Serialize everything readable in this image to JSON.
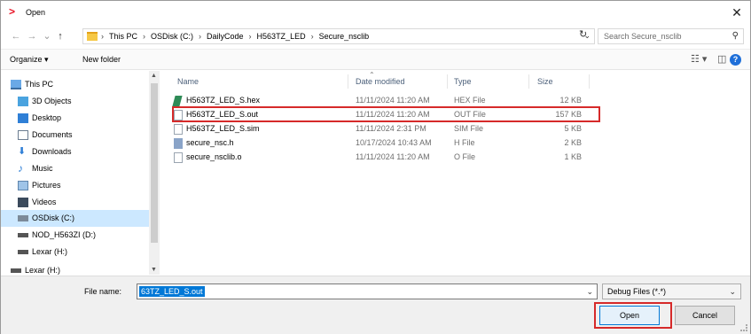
{
  "window": {
    "title": "Open",
    "close": "✕"
  },
  "nav": {
    "back": "←",
    "forward": "→",
    "up": "↑",
    "crumbs": [
      "This PC",
      "OSDisk (C:)",
      "DailyCode",
      "H563TZ_LED",
      "Secure_nsclib"
    ],
    "crumb_sep": "›",
    "dropdown": "⌄",
    "refresh": "↻",
    "search_placeholder": "Search Secure_nsclib"
  },
  "toolbar": {
    "organize": "Organize ▾",
    "new_folder": "New folder"
  },
  "sidebar": {
    "items": [
      {
        "label": "This PC",
        "icon": "pc-icon"
      },
      {
        "label": "3D Objects",
        "icon": "cube-icon"
      },
      {
        "label": "Desktop",
        "icon": "desktop-icon"
      },
      {
        "label": "Documents",
        "icon": "documents-icon"
      },
      {
        "label": "Downloads",
        "icon": "download-icon"
      },
      {
        "label": "Music",
        "icon": "music-icon"
      },
      {
        "label": "Pictures",
        "icon": "pictures-icon"
      },
      {
        "label": "Videos",
        "icon": "videos-icon"
      },
      {
        "label": "OSDisk (C:)",
        "icon": "drive-icon"
      },
      {
        "label": "NOD_H563ZI (D:)",
        "icon": "drive-icon"
      },
      {
        "label": "Lexar (H:)",
        "icon": "drive-icon"
      },
      {
        "label": "Lexar (H:)",
        "icon": "drive-icon"
      }
    ],
    "selected_index": 8
  },
  "columns": {
    "name": "Name",
    "date": "Date modified",
    "type": "Type",
    "size": "Size"
  },
  "files": [
    {
      "name": "H563TZ_LED_S.hex",
      "date": "11/11/2024 11:20 AM",
      "type": "HEX File",
      "size": "12 KB",
      "icon": "hex"
    },
    {
      "name": "H563TZ_LED_S.out",
      "date": "11/11/2024 11:20 AM",
      "type": "OUT File",
      "size": "157 KB",
      "icon": "file"
    },
    {
      "name": "H563TZ_LED_S.sim",
      "date": "11/11/2024 2:31 PM",
      "type": "SIM File",
      "size": "5 KB",
      "icon": "file"
    },
    {
      "name": "secure_nsc.h",
      "date": "10/17/2024 10:43 AM",
      "type": "H File",
      "size": "2 KB",
      "icon": "h"
    },
    {
      "name": "secure_nsclib.o",
      "date": "11/11/2024 11:20 AM",
      "type": "O File",
      "size": "1 KB",
      "icon": "file"
    }
  ],
  "bottom": {
    "file_name_label": "File name:",
    "file_name_value": "63TZ_LED_S.out",
    "file_type": "Debug Files (*.*)",
    "open": "Open",
    "cancel": "Cancel"
  },
  "colors": {
    "highlight": "#d62a2a",
    "selection": "#0078d7"
  }
}
